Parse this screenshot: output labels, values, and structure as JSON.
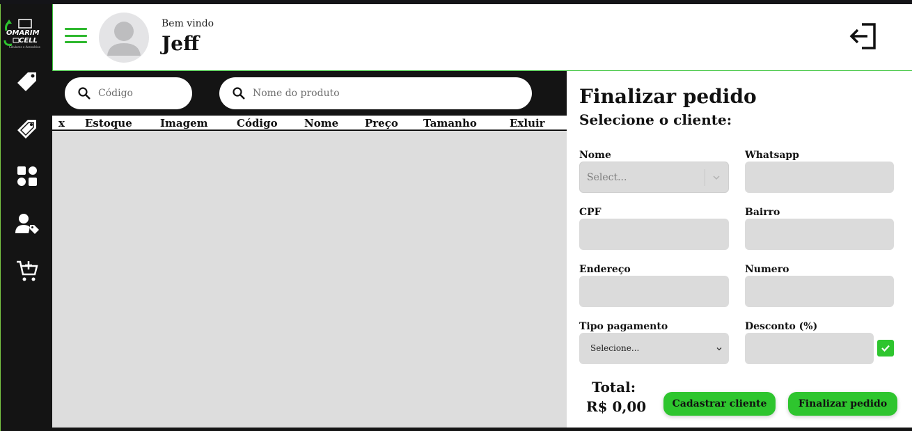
{
  "brand": {
    "logo_line1": "OMARIM",
    "logo_line2": "CELL",
    "logo_tagline": "Celulares e Acessórios",
    "accent": "#2ec52e"
  },
  "sidebar": {
    "items": [
      {
        "icon": "tag-icon"
      },
      {
        "icon": "tag-outline-icon"
      },
      {
        "icon": "categories-icon"
      },
      {
        "icon": "user-tag-icon"
      },
      {
        "icon": "cart-add-icon"
      }
    ]
  },
  "header": {
    "welcome": "Bem vindo",
    "username": "Jeff",
    "menu_icon": "hamburger-icon",
    "logout_icon": "logout-icon"
  },
  "search": {
    "code_placeholder": "Código",
    "name_placeholder": "Nome do produto"
  },
  "table": {
    "columns": [
      "x",
      "Estoque",
      "Imagem",
      "Código",
      "Nome",
      "Preço",
      "Tamanho",
      "Exluir"
    ],
    "rows": []
  },
  "order": {
    "title": "Finalizar pedido",
    "subtitle": "Selecione o cliente:",
    "fields": {
      "nome_label": "Nome",
      "nome_placeholder": "Select...",
      "whatsapp_label": "Whatsapp",
      "cpf_label": "CPF",
      "bairro_label": "Bairro",
      "endereco_label": "Endereço",
      "numero_label": "Numero",
      "pagamento_label": "Tipo pagamento",
      "pagamento_value": "Selecione...",
      "desconto_label": "Desconto (%)"
    },
    "total_label": "Total:",
    "total_value": "R$ 0,00",
    "register_button": "Cadastrar cliente",
    "finish_button": "Finalizar pedido"
  }
}
